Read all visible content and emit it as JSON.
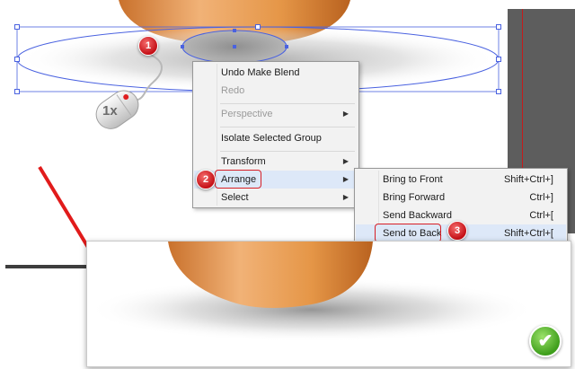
{
  "context_menu": {
    "items": [
      {
        "label": "Undo Make Blend",
        "enabled": true,
        "submenu": false
      },
      {
        "label": "Redo",
        "enabled": false,
        "submenu": false
      },
      {
        "label": "Perspective",
        "enabled": false,
        "submenu": true
      },
      {
        "label": "Isolate Selected Group",
        "enabled": true,
        "submenu": false
      },
      {
        "label": "Transform",
        "enabled": true,
        "submenu": true
      },
      {
        "label": "Arrange",
        "enabled": true,
        "submenu": true,
        "highlighted": true
      },
      {
        "label": "Select",
        "enabled": true,
        "submenu": true
      }
    ]
  },
  "arrange_submenu": {
    "items": [
      {
        "label": "Bring to Front",
        "shortcut": "Shift+Ctrl+]"
      },
      {
        "label": "Bring Forward",
        "shortcut": "Ctrl+]"
      },
      {
        "label": "Send Backward",
        "shortcut": "Ctrl+["
      },
      {
        "label": "Send to Back",
        "shortcut": "Shift+Ctrl+[",
        "highlighted": true
      }
    ]
  },
  "steps": {
    "one": "1",
    "two": "2",
    "three": "3"
  },
  "mouse": {
    "click_count": "1x",
    "icon": "mouse-icon"
  },
  "result": {
    "status_icon": "checkmark-icon"
  },
  "colors": {
    "accent_red": "#d71f26",
    "success_green": "#3e9e1b",
    "orange_object": "#d98a3d",
    "dark_panel": "#5d5d5d"
  }
}
